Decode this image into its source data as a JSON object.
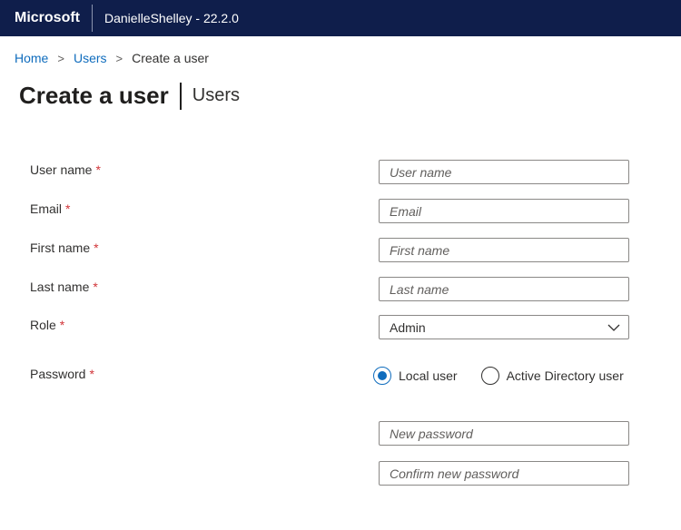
{
  "header": {
    "brand": "Microsoft",
    "app_title": "DanielleShelley - 22.2.0",
    "background_color": "#0f1e4b"
  },
  "breadcrumb": {
    "items": [
      "Home",
      "Users"
    ],
    "separator": ">",
    "current": "Create a user"
  },
  "page": {
    "title": "Create a user",
    "subtitle": "Users"
  },
  "form": {
    "required_marker": "*",
    "username": {
      "label": "User name",
      "placeholder": "User name",
      "value": ""
    },
    "email": {
      "label": "Email",
      "placeholder": "Email",
      "value": ""
    },
    "first_name": {
      "label": "First name",
      "placeholder": "First name",
      "value": ""
    },
    "last_name": {
      "label": "Last name",
      "placeholder": "Last name",
      "value": ""
    },
    "role": {
      "label": "Role",
      "selected": "Admin",
      "icon": "chevron-down-icon"
    },
    "password": {
      "label": "Password",
      "options": [
        {
          "label": "Local user",
          "selected": true
        },
        {
          "label": "Active Directory user",
          "selected": false
        }
      ],
      "new_password_placeholder": "New password",
      "confirm_password_placeholder": "Confirm new password"
    }
  },
  "colors": {
    "accent": "#0f6cbd",
    "required": "#d13438"
  }
}
